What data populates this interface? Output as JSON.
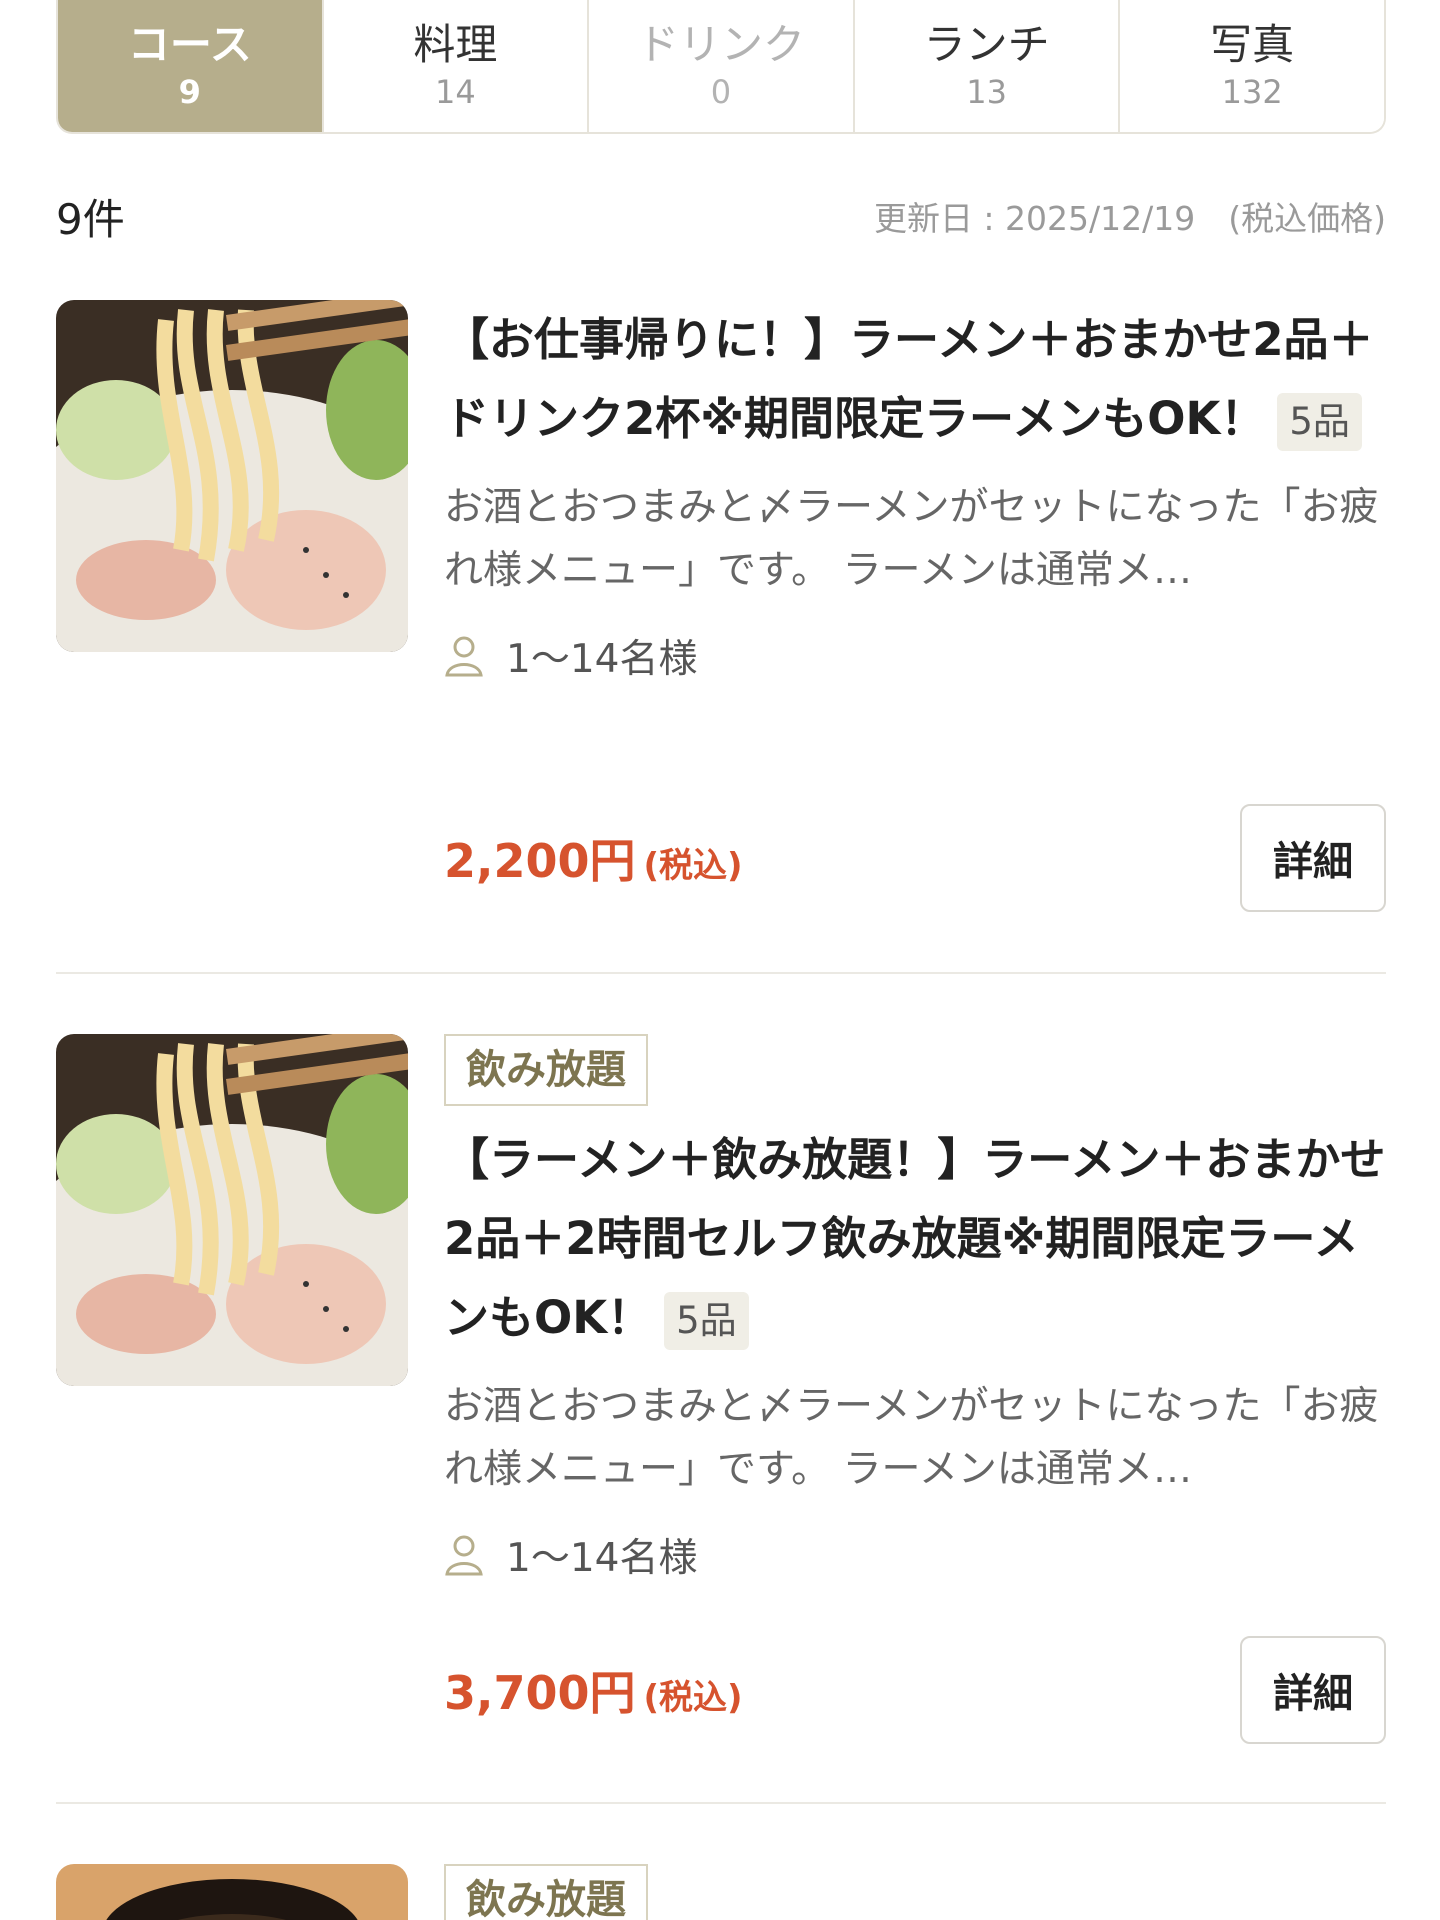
{
  "tabs": [
    {
      "label": "コース",
      "count": "9"
    },
    {
      "label": "料理",
      "count": "14"
    },
    {
      "label": "ドリンク",
      "count": "0"
    },
    {
      "label": "ランチ",
      "count": "13"
    },
    {
      "label": "写真",
      "count": "132"
    }
  ],
  "active_tab": "コース",
  "list": {
    "count_label": "9件",
    "updated_label": "更新日 : 2025/12/19　(税込価格)"
  },
  "courses": [
    {
      "title": "【お仕事帰りに！】ラーメン＋おまかせ2品＋ドリンク2杯※期間限定ラーメンもOK！",
      "items_badge": "5品",
      "description": "お酒とおつまみと〆ラーメンがセットになった「お疲れ様メニュー」です。 ラーメンは通常メ…",
      "people": "1〜14名様",
      "price": "2,200円",
      "tax_label": "(税込)",
      "detail_label": "詳細",
      "thumbnail": "ramen-photo"
    },
    {
      "tag": "飲み放題",
      "title": "【ラーメン＋飲み放題！】ラーメン＋おまかせ2品＋2時間セルフ飲み放題※期間限定ラーメンもOK！",
      "items_badge": "5品",
      "description": "お酒とおつまみと〆ラーメンがセットになった「お疲れ様メニュー」です。 ラーメンは通常メ…",
      "people": "1〜14名様",
      "price": "3,700円",
      "tax_label": "(税込)",
      "detail_label": "詳細",
      "thumbnail": "ramen-photo"
    },
    {
      "tag": "飲み放題",
      "thumbnail": "food-photo"
    }
  ],
  "colors": {
    "active_tab_bg": "#b6ae8c",
    "price": "#d6532e",
    "tag_text": "#7d7550"
  }
}
